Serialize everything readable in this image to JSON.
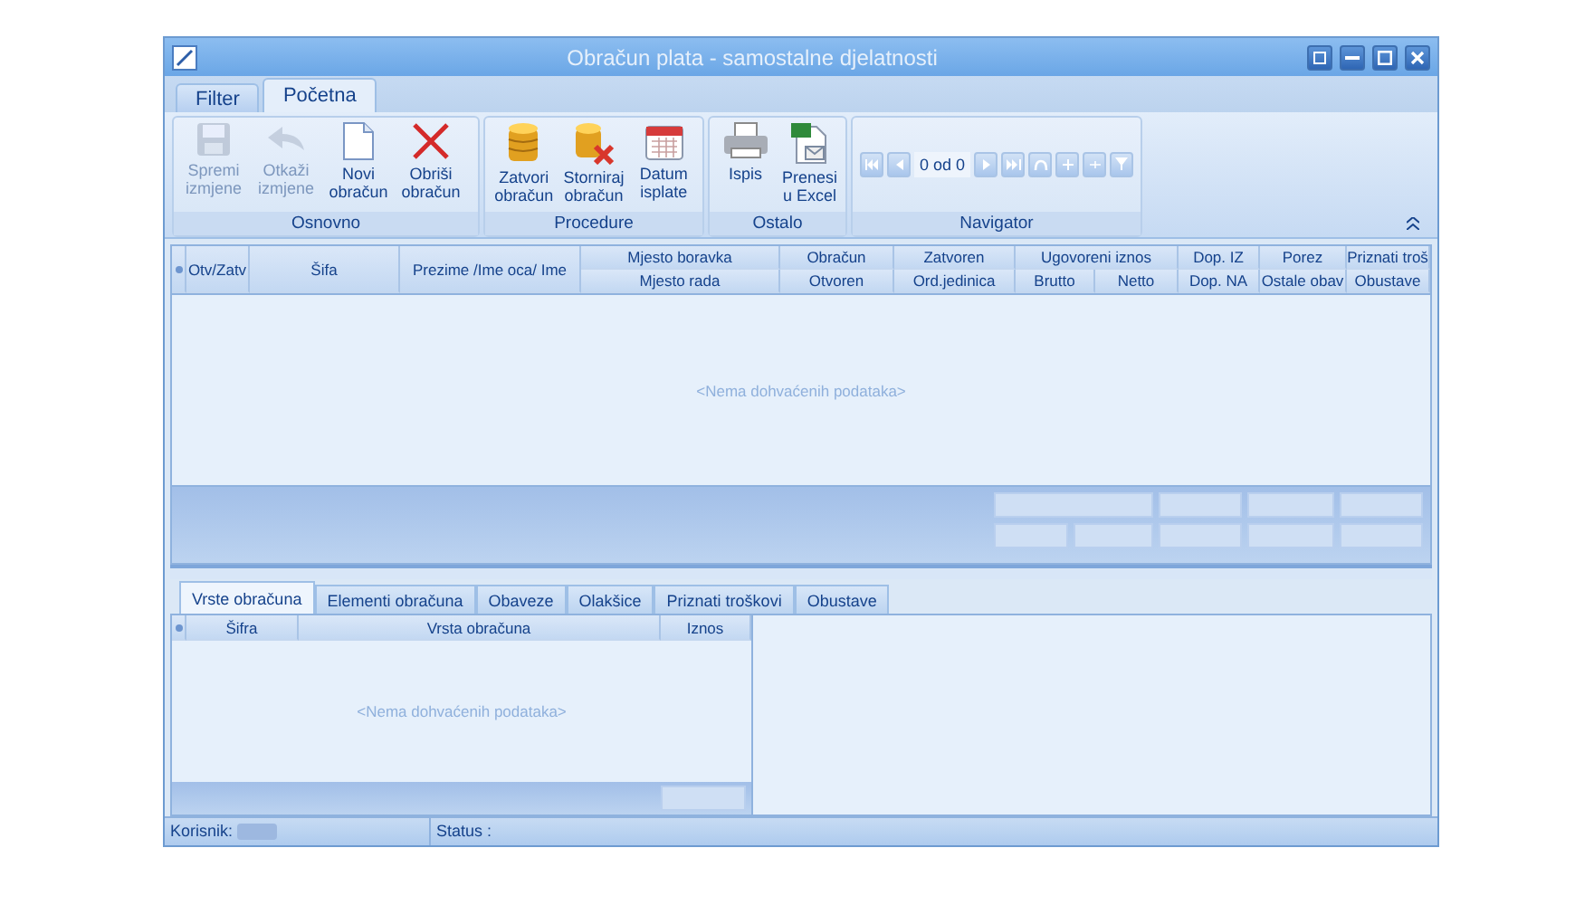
{
  "window": {
    "title": "Obračun plata - samostalne djelatnosti"
  },
  "ribbon_tabs": [
    {
      "label": "Filter",
      "selected": false
    },
    {
      "label": "Početna",
      "selected": true
    }
  ],
  "ribbon_groups": [
    {
      "label": "Osnovno",
      "buttons": [
        {
          "kind": "save",
          "label": "Spremi izmjene",
          "disabled": true
        },
        {
          "kind": "undo",
          "label": "Otkaži izmjene",
          "disabled": true
        },
        {
          "kind": "page",
          "label": "Novi obračun",
          "disabled": false
        },
        {
          "kind": "delete",
          "label": "Obriši obračun",
          "disabled": false
        }
      ]
    },
    {
      "label": "Procedure",
      "buttons": [
        {
          "kind": "coins",
          "label": "Zatvori obračun",
          "disabled": false
        },
        {
          "kind": "coins-x",
          "label": "Storniraj obračun",
          "disabled": false
        },
        {
          "kind": "calendar",
          "label": "Datum isplate",
          "disabled": false
        }
      ]
    },
    {
      "label": "Ostalo",
      "buttons": [
        {
          "kind": "printer",
          "label": "Ispis",
          "disabled": false
        },
        {
          "kind": "excel",
          "label": "Prenesi u Excel",
          "disabled": false
        }
      ]
    }
  ],
  "navigator": {
    "label": "Navigator",
    "position": "0 od 0"
  },
  "grid": {
    "columns": [
      {
        "kind": "single",
        "label": "Otv/Zatv"
      },
      {
        "kind": "single",
        "label": "Šifa"
      },
      {
        "kind": "single",
        "label": "Prezime /Ime oca/ Ime"
      },
      {
        "kind": "stacked",
        "top": "Mjesto boravka",
        "bottom": "Mjesto rada"
      },
      {
        "kind": "stacked",
        "top": "Obračun",
        "bottom": "Otvoren"
      },
      {
        "kind": "stacked",
        "top": "Zatvoren",
        "bottom": "Ord.jedinica"
      },
      {
        "kind": "group",
        "label": "Ugovoreni iznos",
        "children": [
          "Brutto",
          "Netto"
        ]
      },
      {
        "kind": "stacked",
        "top": "Dop. IZ",
        "bottom": "Dop. NA"
      },
      {
        "kind": "stacked",
        "top": "Porez",
        "bottom": "Ostale obav"
      },
      {
        "kind": "stacked",
        "top": "Priznati troš",
        "bottom": "Obustave"
      }
    ],
    "empty_text": "<Nema dohvaćenih podataka>"
  },
  "detail_tabs": [
    {
      "label": "Vrste obračuna",
      "selected": true
    },
    {
      "label": "Elementi obračuna",
      "selected": false
    },
    {
      "label": "Obaveze",
      "selected": false
    },
    {
      "label": "Olakšice",
      "selected": false
    },
    {
      "label": "Priznati troškovi",
      "selected": false
    },
    {
      "label": "Obustave",
      "selected": false
    }
  ],
  "detail_grid": {
    "columns": [
      "Šifra",
      "Vrsta obračuna",
      "Iznos"
    ],
    "empty_text": "<Nema dohvaćenih podataka>"
  },
  "status_bar": {
    "user_label": "Korisnik:",
    "status_label": "Status :"
  }
}
